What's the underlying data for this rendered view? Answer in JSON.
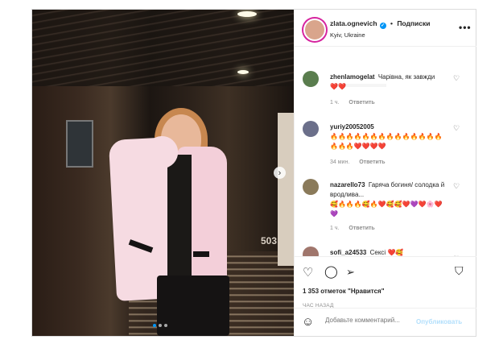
{
  "photo": {
    "room_number": "503",
    "carousel": {
      "dots": 3,
      "active_index": 0
    }
  },
  "header": {
    "username": "zlata.ognevich",
    "follow_label": "Подписки",
    "location": "Kyiv, Ukraine",
    "more_label": "•••"
  },
  "comments": [
    {
      "user": "zhenlamogelat",
      "text": "Чарівна, як завжди",
      "emoji": "❤️❤️",
      "time": "1 ч.",
      "reply": "Ответить",
      "avatar_color": "#5a7d4e"
    },
    {
      "user": "yuriy20052005",
      "text": "",
      "emoji": "🔥🔥🔥🔥🔥🔥🔥🔥🔥🔥🔥🔥🔥🔥🔥🔥🔥❤️❤️❤️❤️",
      "time": "34 мин.",
      "reply": "Ответить",
      "avatar_color": "#6b6f8a"
    },
    {
      "user": "nazarello73",
      "text": "Гаряча богиня/ солодка й вродлива...",
      "emoji": "🥰🔥🔥🔥🥰🔥❤️🥰🥰❤️💜❤️🌸❤️💜",
      "time": "1 ч.",
      "reply": "Ответить",
      "avatar_color": "#8a7a5a"
    },
    {
      "user": "sofi_a24533",
      "text": "Сексі",
      "emoji": "❤️🥰",
      "time": "",
      "reply": "",
      "avatar_color": "#a0766c"
    }
  ],
  "actions": {
    "likes": "1 353 отметок \"Нравится\"",
    "time_ago": "час назад"
  },
  "composer": {
    "placeholder": "Добавьте комментарий...",
    "publish_label": "Опубликовать"
  },
  "colors": {
    "accent": "#0095f6",
    "publish_disabled": "#b2dffc",
    "border": "#dbdbdb"
  }
}
